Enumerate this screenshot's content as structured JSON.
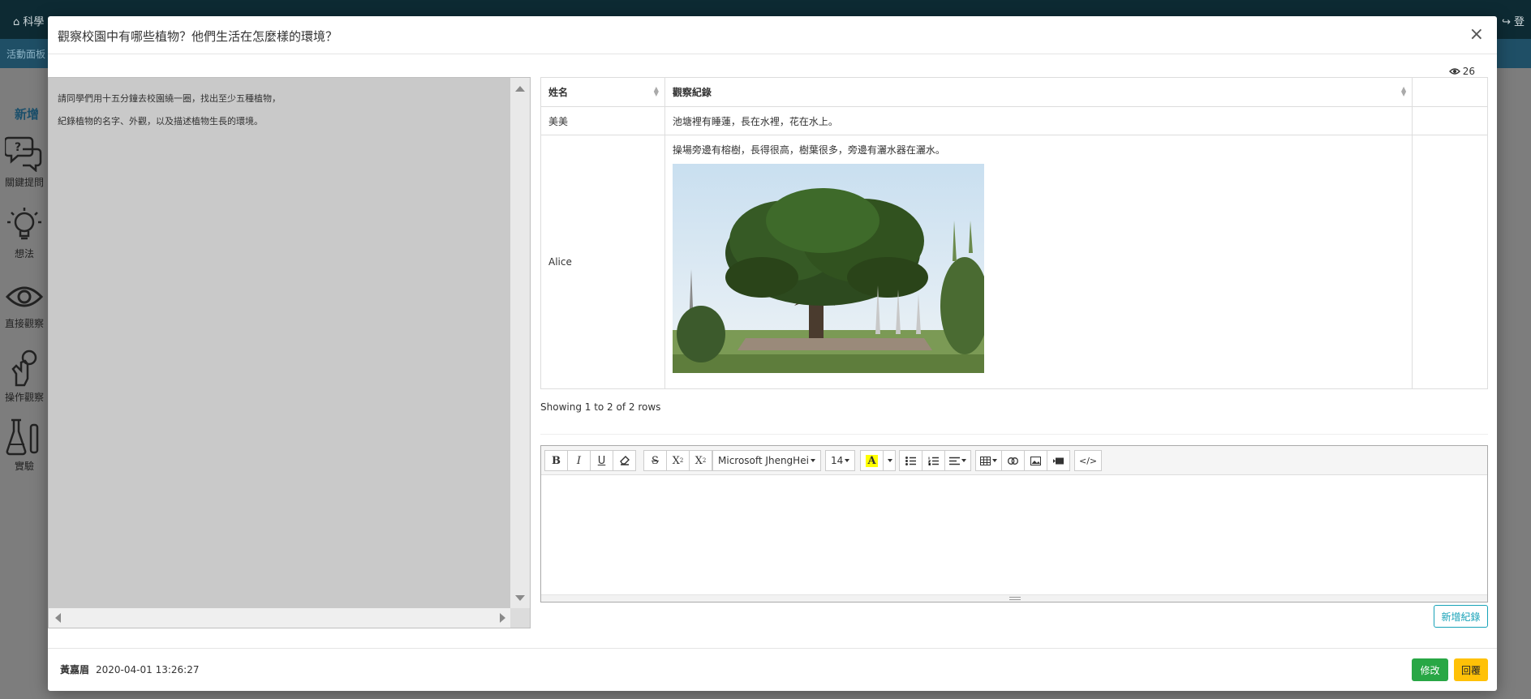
{
  "app": {
    "brand": "科學",
    "topbar_right": "登",
    "subbar_label": "活動面板",
    "sidebar": {
      "new_label": "新增",
      "items": [
        {
          "label": "關鍵提問",
          "icon": "question-chat-icon"
        },
        {
          "label": "想法",
          "icon": "lightbulb-icon"
        },
        {
          "label": "直接觀察",
          "icon": "eye-icon"
        },
        {
          "label": "操作觀察",
          "icon": "hand-operate-icon"
        },
        {
          "label": "實驗",
          "icon": "flask-icon"
        }
      ]
    }
  },
  "modal": {
    "title": "觀察校園中有哪些植物？他們生活在怎麼樣的環境？",
    "close": "×",
    "views": "26",
    "instructions": [
      "請同學們用十五分鐘去校園繞一圈，找出至少五種植物，",
      "紀錄植物的名字、外觀，以及描述植物生長的環境。"
    ],
    "table": {
      "headers": [
        "姓名",
        "觀察紀錄",
        ""
      ],
      "rows": [
        {
          "name": "美美",
          "record": "池塘裡有睡蓮，長在水裡，花在水上。"
        },
        {
          "name": "Alice",
          "record": "操場旁邊有榕樹，長得很高，樹葉很多，旁邊有灑水器在灑水。"
        }
      ],
      "footer": "Showing 1 to 2 of 2 rows"
    },
    "editor": {
      "toolbar": {
        "bold": "B",
        "italic": "I",
        "underline": "U",
        "strikethrough": "S",
        "superscript": "X",
        "subscript": "X",
        "font_name": "Microsoft JhengHei",
        "font_size": "14",
        "color_letter": "A",
        "code_view": "</>"
      }
    },
    "add_button": "新增紀錄",
    "footer": {
      "author": "黃嘉眉",
      "timestamp": "2020-04-01 13:26:27",
      "edit_button": "修改",
      "reply_button": "回覆"
    }
  },
  "colors": {
    "topbar": "#0d2a33",
    "edit": "#28a745",
    "reply": "#ffc107",
    "add": "#17a2b8"
  }
}
